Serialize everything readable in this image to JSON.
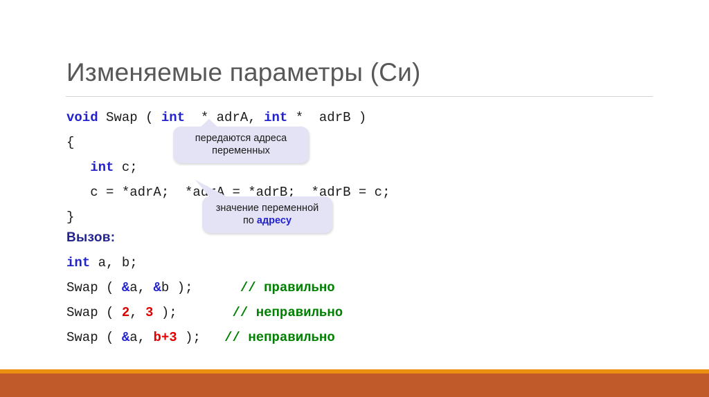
{
  "slide": {
    "title": "Изменяемые параметры (Си)"
  },
  "code": {
    "lines": [
      [
        {
          "t": "void",
          "c": "kw"
        },
        {
          "t": " Swap ( ",
          "c": "plain"
        },
        {
          "t": "int",
          "c": "kw"
        },
        {
          "t": "  * adrA, ",
          "c": "plain"
        },
        {
          "t": "int",
          "c": "kw"
        },
        {
          "t": " *  adrB )",
          "c": "plain"
        }
      ],
      [
        {
          "t": "{",
          "c": "plain"
        }
      ],
      [
        {
          "t": "   ",
          "c": "plain"
        },
        {
          "t": "int",
          "c": "kw"
        },
        {
          "t": " c;",
          "c": "plain"
        }
      ],
      [
        {
          "t": "   c = *adrA;  *adrA = *adrB;  *adrB = c;",
          "c": "plain"
        }
      ],
      [
        {
          "t": "}",
          "c": "plain"
        }
      ]
    ]
  },
  "call_label": "Вызов:",
  "call_code": {
    "lines": [
      [
        {
          "t": "int",
          "c": "kw"
        },
        {
          "t": " a, b;",
          "c": "plain"
        }
      ],
      [
        {
          "t": "Swap ( ",
          "c": "plain"
        },
        {
          "t": "&",
          "c": "amp"
        },
        {
          "t": "a, ",
          "c": "plain"
        },
        {
          "t": "&",
          "c": "amp"
        },
        {
          "t": "b );",
          "c": "plain"
        },
        {
          "t": "      ",
          "c": "plain"
        },
        {
          "t": "// правильно",
          "c": "cmt"
        }
      ],
      [
        {
          "t": "Swap ( ",
          "c": "plain"
        },
        {
          "t": "2",
          "c": "num"
        },
        {
          "t": ", ",
          "c": "plain"
        },
        {
          "t": "3",
          "c": "num"
        },
        {
          "t": " );",
          "c": "plain"
        },
        {
          "t": "       ",
          "c": "plain"
        },
        {
          "t": "// неправильно",
          "c": "cmt"
        }
      ],
      [
        {
          "t": "Swap ( ",
          "c": "plain"
        },
        {
          "t": "&",
          "c": "amp"
        },
        {
          "t": "a, ",
          "c": "plain"
        },
        {
          "t": "b+3",
          "c": "num"
        },
        {
          "t": " );",
          "c": "plain"
        },
        {
          "t": "   ",
          "c": "plain"
        },
        {
          "t": "// неправильно",
          "c": "cmt"
        }
      ]
    ]
  },
  "callouts": {
    "addresses": {
      "line1": "передаются адреса",
      "line2": "переменных"
    },
    "value": {
      "line1": "значение переменной",
      "line2_prefix": "по ",
      "line2_highlight": "адресу"
    }
  },
  "colors": {
    "keyword": "#2222cc",
    "number": "#e00000",
    "comment": "#008000",
    "title": "#585858",
    "callout_bg": "#e4e3f5",
    "bar_orange": "#eb9012",
    "bar_terracotta": "#c05a2b",
    "call_label": "#23238e"
  }
}
